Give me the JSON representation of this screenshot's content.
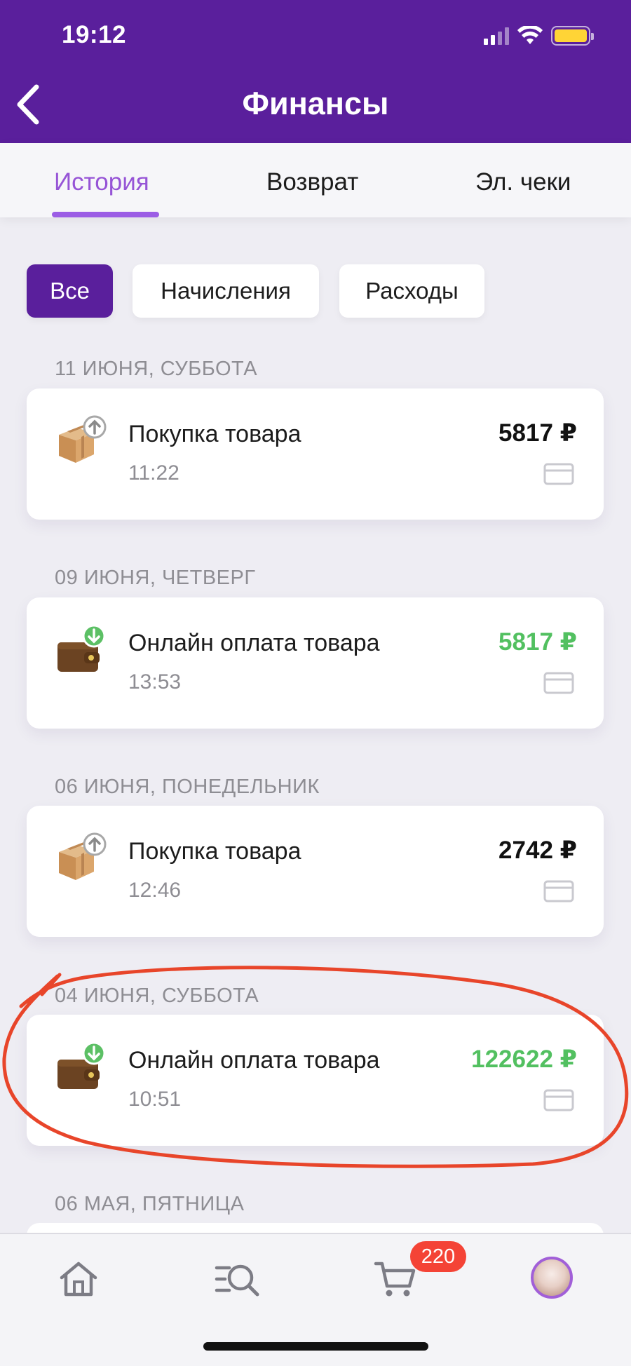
{
  "status_bar": {
    "time": "19:12"
  },
  "header": {
    "title": "Финансы"
  },
  "tabs": [
    {
      "label": "История",
      "active": true
    },
    {
      "label": "Возврат",
      "active": false
    },
    {
      "label": "Эл. чеки",
      "active": false
    }
  ],
  "filters": [
    {
      "label": "Все",
      "active": true
    },
    {
      "label": "Начисления",
      "active": false
    },
    {
      "label": "Расходы",
      "active": false
    }
  ],
  "sections": [
    {
      "date": "11 ИЮНЯ, СУББОТА",
      "name": "Покупка товара",
      "time": "11:22",
      "amount": "5817 ₽",
      "type": "purchase",
      "icon": "box-upload-icon"
    },
    {
      "date": "09 ИЮНЯ, ЧЕТВЕРГ",
      "name": "Онлайн оплата товара",
      "time": "13:53",
      "amount": "5817 ₽",
      "type": "income",
      "icon": "wallet-download-icon"
    },
    {
      "date": "06 ИЮНЯ, ПОНЕДЕЛЬНИК",
      "name": "Покупка товара",
      "time": "12:46",
      "amount": "2742 ₽",
      "type": "purchase",
      "icon": "box-upload-icon"
    },
    {
      "date": "04 ИЮНЯ, СУББОТА",
      "name": "Онлайн оплата товара",
      "time": "10:51",
      "amount": "122622 ₽",
      "type": "income",
      "icon": "wallet-download-icon"
    },
    {
      "date": "06 МАЯ, ПЯТНИЦА"
    }
  ],
  "bottom_nav": {
    "items": [
      "home-icon",
      "catalog-search-icon",
      "cart-icon",
      "profile-avatar"
    ],
    "cart_badge": "220"
  },
  "colors": {
    "brand": "#5a1f9c",
    "tab_active": "#9654d6",
    "income": "#52c060",
    "badge": "#f44336",
    "annotation": "#e8452a"
  }
}
